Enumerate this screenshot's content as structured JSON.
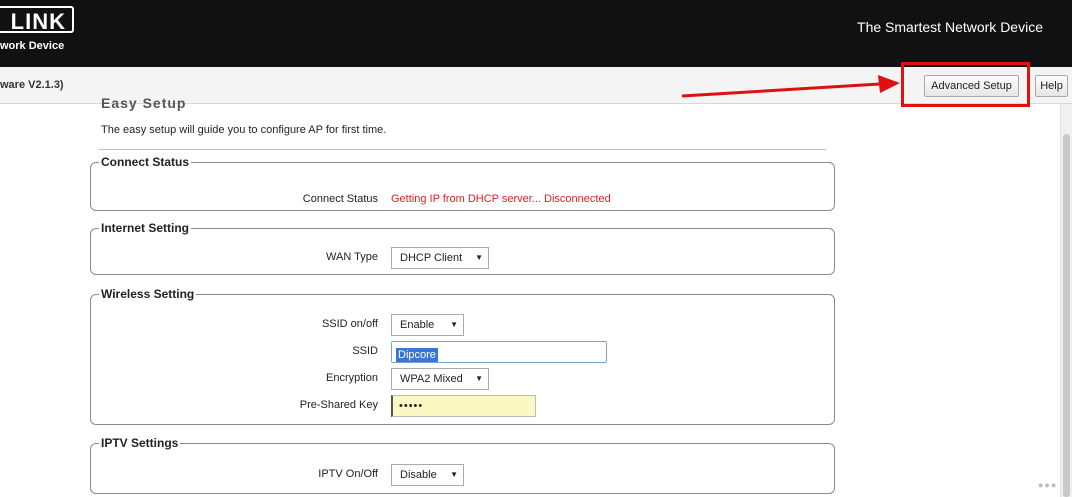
{
  "header": {
    "logo_text": "LINK",
    "logo_subtitle": "work Device",
    "tagline": "The Smartest Network Device"
  },
  "toolbar": {
    "firmware": "ware V2.1.3)",
    "advanced_setup_label": "Advanced Setup",
    "help_label": "Help"
  },
  "page": {
    "title": "Easy Setup",
    "intro": "The easy setup will guide you to configure AP for first time."
  },
  "connect_status": {
    "legend": "Connect Status",
    "status_label": "Connect Status",
    "status_value": "Getting IP from DHCP server... Disconnected"
  },
  "internet_setting": {
    "legend": "Internet Setting",
    "wan_type_label": "WAN Type",
    "wan_type_value": "DHCP Client"
  },
  "wireless_setting": {
    "legend": "Wireless Setting",
    "ssid_onoff_label": "SSID on/off",
    "ssid_onoff_value": "Enable",
    "ssid_label": "SSID",
    "ssid_value": "Dipcore",
    "encryption_label": "Encryption",
    "encryption_value": "WPA2 Mixed",
    "psk_label": "Pre-Shared Key",
    "psk_value": "•••••"
  },
  "iptv_settings": {
    "legend": "IPTV Settings",
    "iptv_label": "IPTV On/Off",
    "iptv_value": "Disable"
  },
  "colors": {
    "header_bg": "#111111",
    "status_error": "#e02020",
    "annotation_red": "#e01010",
    "selection_blue": "#3875d7",
    "password_bg": "#fbf8c4"
  },
  "icons": {
    "dropdown": "triangle-down",
    "annotation_arrow": "arrow-right"
  }
}
